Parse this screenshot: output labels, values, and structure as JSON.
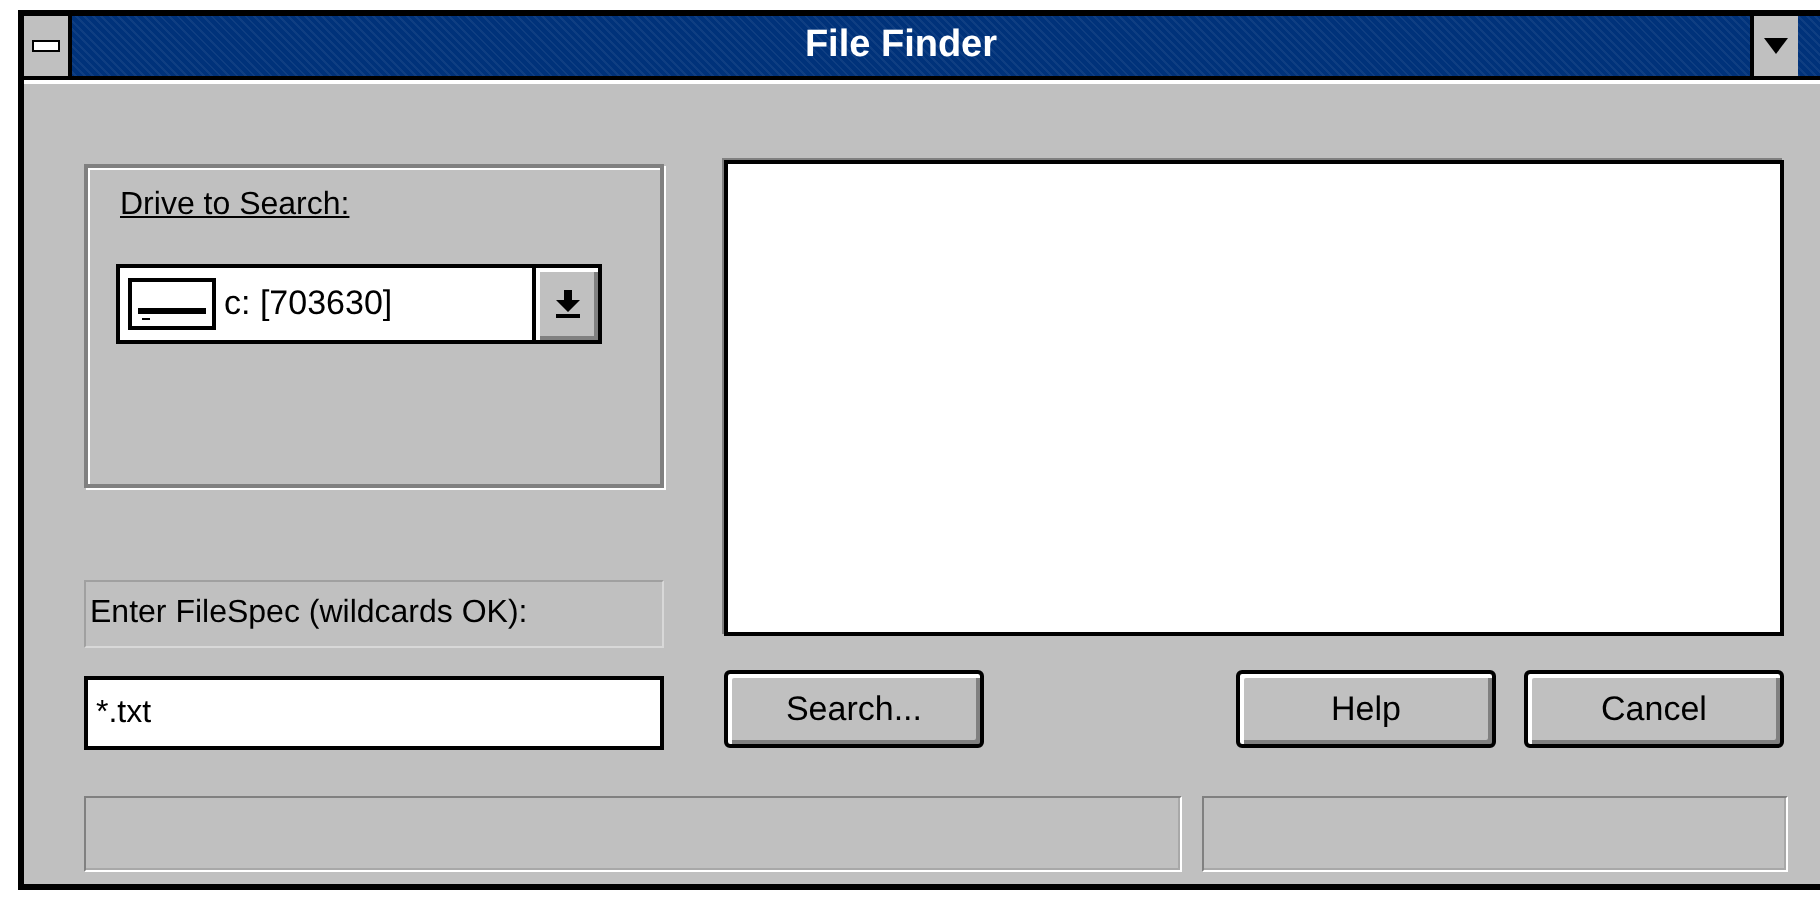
{
  "window": {
    "title": "File Finder"
  },
  "drive_group": {
    "label": "Drive to Search:",
    "drive": {
      "value": "c: [703630]"
    }
  },
  "filespec": {
    "label": "Enter FileSpec (wildcards OK):",
    "value": "*.txt"
  },
  "buttons": [
    {
      "label": "Search...",
      "kind": "left"
    },
    {
      "label": "Help",
      "kind": "right"
    },
    {
      "label": "Cancel",
      "kind": "right"
    }
  ]
}
